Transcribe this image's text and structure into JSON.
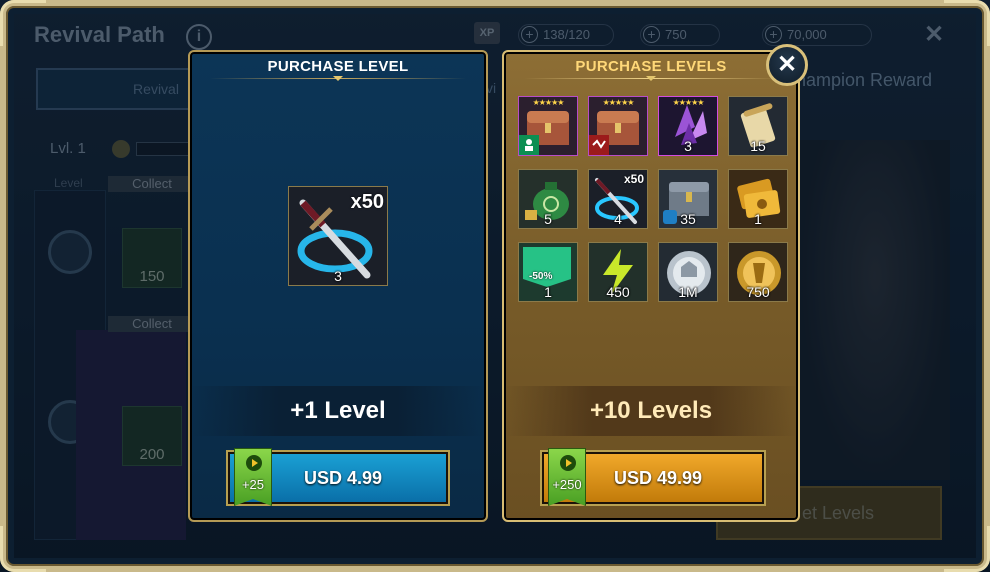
{
  "background": {
    "title": "Revival Path",
    "info_glyph": "i",
    "xp_badge": "XP",
    "energy": "138/120",
    "energy_second": "750",
    "gems": "70,000",
    "close_glyph": "✕",
    "tab_revival": "Revival",
    "tab_partial": "vi",
    "champion_reward": "hampion Reward",
    "level": "Lvl. 1",
    "level_header": "Level",
    "collect_1": "Collect",
    "collect_2": "Collect",
    "tile_1_qty": "150",
    "tile_2_qty": "200",
    "get_levels": "et Levels"
  },
  "single_panel": {
    "title": "PURCHASE LEVEL",
    "item": {
      "icon": "sword-ring-icon",
      "multiplier": "x50",
      "qty": "3"
    },
    "level_text": "+1 Level",
    "bonus": "+25",
    "price": "USD 4.99"
  },
  "multi_panel": {
    "title": "PURCHASE LEVELS",
    "close_glyph": "✕",
    "items": [
      {
        "icon": "chest-green-icon",
        "stars": "★★★★★",
        "qty": ""
      },
      {
        "icon": "chest-red-icon",
        "stars": "★★★★★",
        "qty": ""
      },
      {
        "icon": "void-shard-icon",
        "stars": "★★★★★",
        "qty": "3"
      },
      {
        "icon": "scroll-tome-icon",
        "stars": "",
        "qty": "15"
      },
      {
        "icon": "silver-bag-icon",
        "stars": "",
        "qty": "5"
      },
      {
        "icon": "sword-ring-icon",
        "stars": "",
        "multiplier": "x50",
        "qty": "4"
      },
      {
        "icon": "iron-chest-icon",
        "stars": "",
        "qty": "35"
      },
      {
        "icon": "gold-tickets-icon",
        "stars": "",
        "qty": "1"
      },
      {
        "icon": "discount-helmet-icon",
        "stars": "",
        "discount": "-50%",
        "qty": "1"
      },
      {
        "icon": "energy-icon",
        "stars": "",
        "qty": "450"
      },
      {
        "icon": "silver-coin-icon",
        "stars": "",
        "qty": "1M"
      },
      {
        "icon": "gold-coin-icon",
        "stars": "",
        "qty": "750"
      }
    ],
    "level_text": "+10 Levels",
    "bonus": "+250",
    "price": "USD 49.99"
  },
  "colors": {
    "blue_panel": "#0c3556",
    "gold_panel": "#8d6e35",
    "blue_button": "#1aa0d4",
    "gold_button": "#f0a82a",
    "frame": "#c9b98a"
  }
}
